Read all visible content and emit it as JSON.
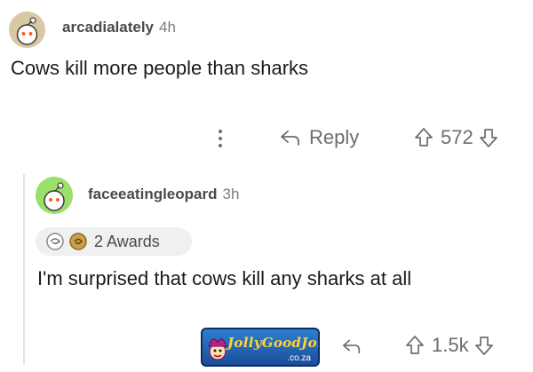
{
  "comment1": {
    "username": "arcadialately",
    "time": "4h",
    "body": "Cows kill more people than sharks",
    "reply_label": "Reply",
    "score": "572"
  },
  "comment2": {
    "username": "faceeatingleopard",
    "time": "3h",
    "awards_label": "2 Awards",
    "body": "I'm surprised that cows kill any sharks at all",
    "score": "1.5k"
  },
  "watermark": {
    "name": "JollyGoodJokes",
    "domain": ".co.za"
  },
  "icons": [
    "more-icon",
    "reply-arrow-icon",
    "upvote-icon",
    "downvote-icon",
    "award-icon"
  ],
  "colors": {
    "avatar1": "#d9c8a6",
    "avatar2": "#9be06a",
    "muted": "#6d6d6d"
  }
}
